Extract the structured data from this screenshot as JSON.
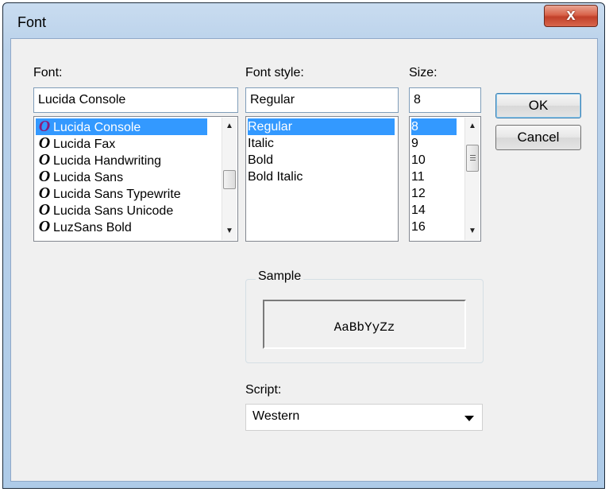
{
  "window": {
    "title": "Font",
    "close_label": "x"
  },
  "font": {
    "label": "Font:",
    "value": "Lucida Console",
    "items": [
      "Lucida Console",
      "Lucida Fax",
      "Lucida Handwriting",
      "Lucida Sans",
      "Lucida Sans Typewrite",
      "Lucida Sans Unicode",
      "LuzSans Bold"
    ],
    "selected_index": 0,
    "glyph": "O"
  },
  "style": {
    "label": "Font style:",
    "value": "Regular",
    "items": [
      "Regular",
      "Italic",
      "Bold",
      "Bold Italic"
    ],
    "selected_index": 0
  },
  "size": {
    "label": "Size:",
    "value": "8",
    "items": [
      "8",
      "9",
      "10",
      "11",
      "12",
      "14",
      "16"
    ],
    "selected_index": 0
  },
  "buttons": {
    "ok": "OK",
    "cancel": "Cancel"
  },
  "sample": {
    "label": "Sample",
    "text": "AaBbYyZz"
  },
  "script": {
    "label": "Script:",
    "value": "Western"
  },
  "colors": {
    "selection": "#3399ff",
    "glyph": "#8b1a7a"
  }
}
